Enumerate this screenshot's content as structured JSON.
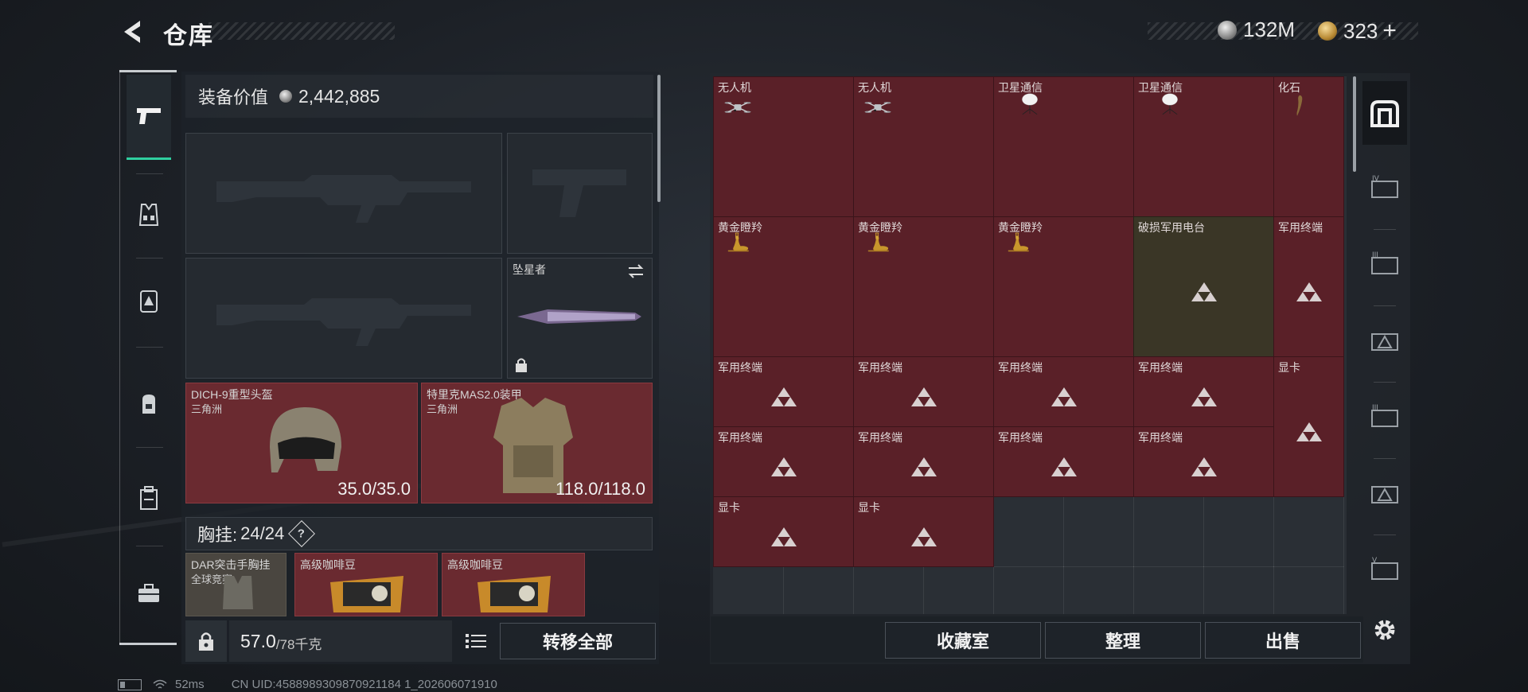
{
  "header": {
    "title": "仓库",
    "currency_silver": "132M",
    "currency_gold": "323",
    "plus": "+"
  },
  "left_nav": {
    "items": [
      {
        "name": "weapons",
        "icon": "pistol-icon",
        "active": true
      },
      {
        "name": "vest",
        "icon": "vest-icon",
        "active": false
      },
      {
        "name": "armor",
        "icon": "armor-plate-icon",
        "active": false
      },
      {
        "name": "backpack",
        "icon": "backpack-icon",
        "active": false
      },
      {
        "name": "container",
        "icon": "case-icon",
        "active": false
      },
      {
        "name": "toolbox",
        "icon": "briefcase-icon",
        "active": false
      }
    ]
  },
  "equipment": {
    "value_label": "装备价值",
    "value": "2,442,885",
    "melee_label": "坠星者",
    "helmet_name": "DICH-9重型头盔",
    "helmet_brand": "三角洲",
    "helmet_durability": "35.0/35.0",
    "armor_name": "特里克MAS2.0装甲",
    "armor_brand": "三角洲",
    "armor_durability": "118.0/118.0",
    "chest_label": "胸挂:",
    "chest_count": "24/24",
    "chest_help": "?",
    "chest_items": [
      {
        "name": "DAR突击手胸挂",
        "sub": "全球竞赛"
      },
      {
        "name": "高级咖啡豆"
      },
      {
        "name": "高级咖啡豆"
      }
    ],
    "weight_current": "57.0",
    "weight_max": "/78千克",
    "transfer_all": "转移全部"
  },
  "storage": {
    "items": [
      {
        "label": "无人机",
        "color": "red",
        "icon": "drone"
      },
      {
        "label": "无人机",
        "color": "red",
        "icon": "drone"
      },
      {
        "label": "卫星通信",
        "color": "red",
        "icon": "satellite-dish"
      },
      {
        "label": "卫星通信",
        "color": "red",
        "icon": "satellite-dish"
      },
      {
        "label": "化石",
        "color": "red",
        "icon": "fossil-claw"
      },
      {
        "label": "黄金瞪羚",
        "color": "red",
        "icon": "golden-gazelle"
      },
      {
        "label": "黄金瞪羚",
        "color": "red",
        "icon": "golden-gazelle"
      },
      {
        "label": "黄金瞪羚",
        "color": "red",
        "icon": "golden-gazelle"
      },
      {
        "label": "破损军用电台",
        "color": "olive",
        "icon": "placeholder-triangle"
      },
      {
        "label": "军用终端",
        "color": "red",
        "icon": "placeholder-triangle"
      },
      {
        "label": "军用终端",
        "color": "red",
        "icon": "placeholder-triangle"
      },
      {
        "label": "军用终端",
        "color": "red",
        "icon": "placeholder-triangle"
      },
      {
        "label": "军用终端",
        "color": "red",
        "icon": "placeholder-triangle"
      },
      {
        "label": "军用终端",
        "color": "red",
        "icon": "placeholder-triangle"
      },
      {
        "label": "显卡",
        "color": "red",
        "icon": "placeholder-triangle"
      },
      {
        "label": "军用终端",
        "color": "red",
        "icon": "placeholder-triangle"
      },
      {
        "label": "军用终端",
        "color": "red",
        "icon": "placeholder-triangle"
      },
      {
        "label": "军用终端",
        "color": "red",
        "icon": "placeholder-triangle"
      },
      {
        "label": "军用终端",
        "color": "red",
        "icon": "placeholder-triangle"
      },
      {
        "label": "显卡",
        "color": "red",
        "icon": "placeholder-triangle"
      },
      {
        "label": "显卡",
        "color": "red",
        "icon": "placeholder-triangle"
      }
    ],
    "buttons": {
      "collection": "收藏室",
      "sort": "整理",
      "sell": "出售"
    }
  },
  "right_nav": {
    "items": [
      {
        "name": "all",
        "icon": "stash-icon",
        "active": true
      },
      {
        "name": "tier-4",
        "icon": "tier-iv-icon"
      },
      {
        "name": "tier-3a",
        "icon": "tier-iii-icon"
      },
      {
        "name": "tier-2",
        "icon": "tier-ii-icon"
      },
      {
        "name": "tier-3b",
        "icon": "tier-iii-icon"
      },
      {
        "name": "tier-1",
        "icon": "tier-i-icon"
      },
      {
        "name": "tier-5",
        "icon": "tier-v-icon"
      }
    ]
  },
  "status": {
    "ping": "52ms",
    "uid": "CN UID:4588989309870921184 1_202606071910"
  },
  "colors": {
    "accent": "#2fd0a0",
    "item_red": "#5a2028",
    "item_olive": "#3a3626",
    "armor_red": "#6a2a30"
  }
}
